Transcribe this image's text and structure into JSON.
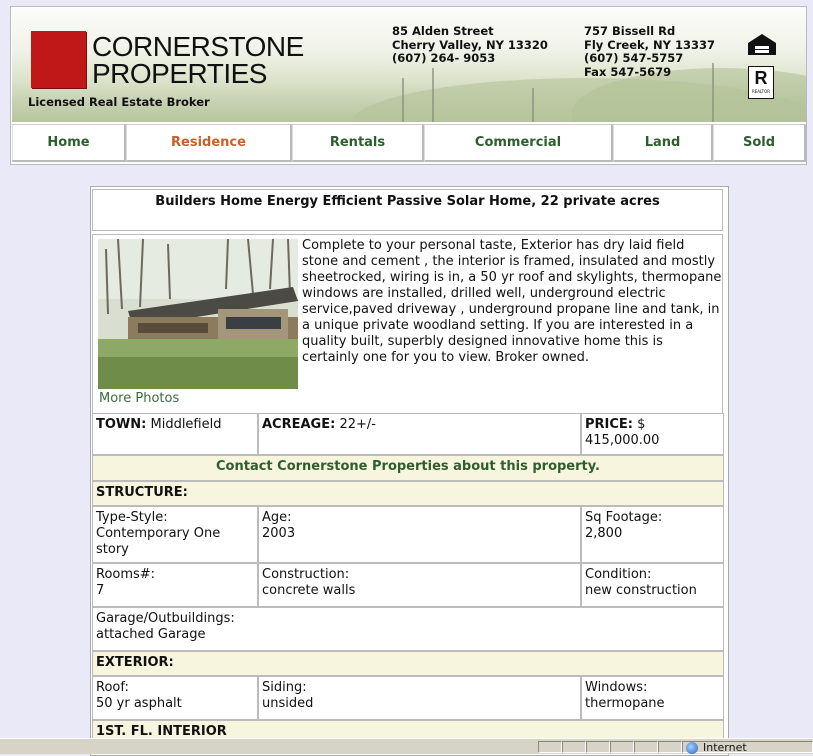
{
  "header": {
    "logo_line1": "CORNERSTONE",
    "logo_line2": "PROPERTIES",
    "tagline": "Licensed Real Estate Broker",
    "office1": {
      "street": "85 Alden Street",
      "city": "Cherry Valley, NY 13320",
      "phone": "(607) 264- 9053"
    },
    "office2": {
      "street": "757 Bissell Rd",
      "city": "Fly Creek, NY 13337",
      "phone": "(607) 547-5757",
      "fax": "Fax 547-5679"
    },
    "eho_icon": "equal-housing-opportunity-icon",
    "realtor_icon": "realtor-icon",
    "realtor_letter": "R",
    "realtor_text": "REALTOR"
  },
  "nav": {
    "items": [
      "Home",
      "Residence",
      "Rentals",
      "Commercial",
      "Land",
      "Sold"
    ],
    "active": "Residence"
  },
  "listing": {
    "title": "Builders Home Energy Efficient Passive Solar Home, 22 private acres",
    "description": "Complete to your personal taste, Exterior has dry laid field stone and cement , the interior is framed, insulated and mostly sheetrocked, wiring is in, a 50 yr roof and skylights, thermopane windows are installed, drilled well, underground electric service,paved driveway , underground propane line and tank, in a unique private woodland setting. If you are interested in a quality built, superbly designed innovative home this is certainly one for you to view. Broker owned.",
    "more_photos": "More Photos",
    "town_label": "TOWN:",
    "town": "Middlefield",
    "acreage_label": "ACREAGE:",
    "acreage": "22+/-",
    "price_label": "PRICE:",
    "price": "$ 415,000.00",
    "contact": "Contact Cornerstone Properties about this property.",
    "structure_heading": "STRUCTURE:",
    "type_style_label": "Type-Style:",
    "type_style": "Contemporary One story",
    "age_label": "Age:",
    "age": "2003",
    "sqft_label": "Sq Footage:",
    "sqft": "2,800",
    "rooms_label": "Rooms#:",
    "rooms": "7",
    "construction_label": "Construction:",
    "construction": "concrete walls",
    "condition_label": "Condition:",
    "condition": "new construction",
    "garage_label": "Garage/Outbuildings:",
    "garage": "attached Garage",
    "exterior_heading": "EXTERIOR:",
    "roof_label": "Roof:",
    "roof": "50 yr asphalt",
    "siding_label": "Siding:",
    "siding": "unsided",
    "windows_label": "Windows:",
    "windows": "thermopane",
    "interior_heading": "1ST. FL. INTERIOR"
  },
  "statusbar": {
    "zone": "Internet",
    "zone_icon": "globe-icon"
  },
  "colors": {
    "accent_green": "#2e5e2e",
    "active_orange": "#c8602a",
    "logo_red": "#c01818",
    "section_bg": "#f7f5de"
  }
}
